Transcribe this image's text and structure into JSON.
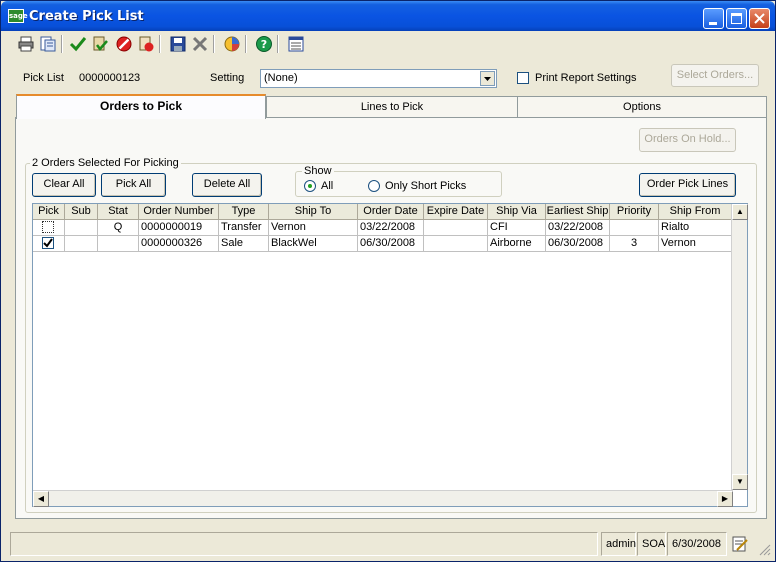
{
  "window": {
    "title": "Create Pick List",
    "logo_text": "sage"
  },
  "toolbar": {
    "icons": [
      "print-icon",
      "preview-icon",
      "accept-icon",
      "post-icon",
      "cancel-icon",
      "delete-icon",
      "save-icon",
      "close-x-icon",
      "chart-icon",
      "help-icon",
      "settings-icon"
    ]
  },
  "header": {
    "pick_list_label": "Pick List",
    "pick_list_value": "0000000123",
    "setting_label": "Setting",
    "setting_value": "(None)",
    "print_report_settings_label": "Print Report Settings",
    "select_orders_label": "Select Orders..."
  },
  "tabs": [
    {
      "label": "Orders to Pick",
      "active": true
    },
    {
      "label": "Lines to Pick",
      "active": false
    },
    {
      "label": "Options",
      "active": false
    }
  ],
  "orders_panel": {
    "orders_on_hold_label": "Orders On Hold...",
    "group_title": "2 Orders Selected For Picking",
    "clear_all_label": "Clear All",
    "pick_all_label": "Pick All",
    "delete_all_label": "Delete All",
    "show_label": "Show",
    "show_all_label": "All",
    "show_short_label": "Only Short Picks",
    "order_pick_lines_label": "Order Pick Lines"
  },
  "grid": {
    "columns": [
      "Pick",
      "Sub",
      "Stat",
      "Order Number",
      "Type",
      "Ship To",
      "Order Date",
      "Expire Date",
      "Ship Via",
      "Earliest Ship",
      "Priority",
      "Ship From"
    ],
    "rows": [
      {
        "pick": false,
        "sub": "",
        "stat": "Q",
        "order_number": "0000000019",
        "type": "Transfer",
        "ship_to": "Vernon",
        "order_date": "03/22/2008",
        "expire_date": "",
        "ship_via": "CFI",
        "earliest_ship": "03/22/2008",
        "priority": "",
        "ship_from": "Rialto"
      },
      {
        "pick": true,
        "sub": "",
        "stat": "",
        "order_number": "0000000326",
        "type": "Sale",
        "ship_to": "BlackWel",
        "order_date": "06/30/2008",
        "expire_date": "",
        "ship_via": "Airborne",
        "earliest_ship": "06/30/2008",
        "priority": "3",
        "ship_from": "Vernon"
      }
    ]
  },
  "status_bar": {
    "user": "admin",
    "company": "SOA",
    "date": "6/30/2008"
  }
}
